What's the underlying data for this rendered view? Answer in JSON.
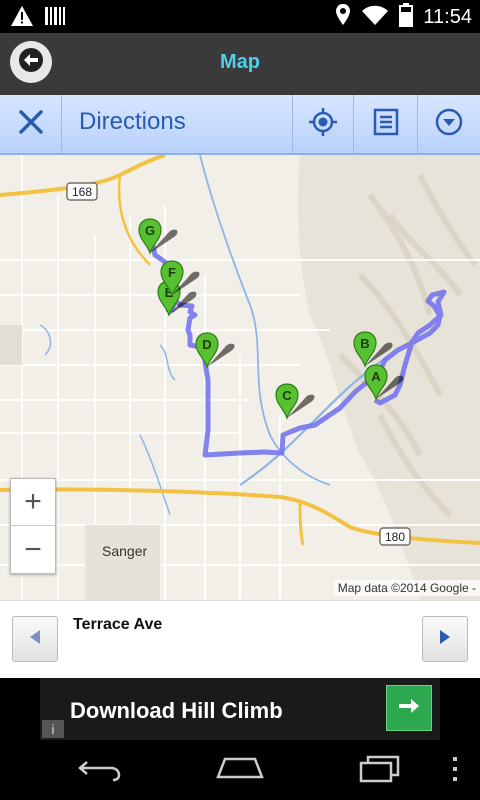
{
  "status_bar": {
    "time": "11:54",
    "icons": [
      "warning-icon",
      "barcode-icon",
      "location-icon",
      "wifi-icon",
      "battery-icon"
    ]
  },
  "header": {
    "title": "Map"
  },
  "toolbar": {
    "title": "Directions"
  },
  "map": {
    "labels": {
      "route_168": "168",
      "route_180": "180",
      "town": "Sanger"
    },
    "markers": [
      "A",
      "B",
      "C",
      "D",
      "E",
      "F",
      "G"
    ],
    "zoom_in": "+",
    "zoom_out": "−",
    "attribution": "Map data ©2014 Google -",
    "route_color": "#6f6ff0",
    "marker_color": "#57c12f"
  },
  "step": {
    "text": "Terrace Ave"
  },
  "ad": {
    "text": "Download Hill Climb",
    "info": "i"
  },
  "colors": {
    "accent": "#4fd0e8",
    "toolbar_text": "#2a5bb0",
    "ad_button": "#2ea84e"
  }
}
